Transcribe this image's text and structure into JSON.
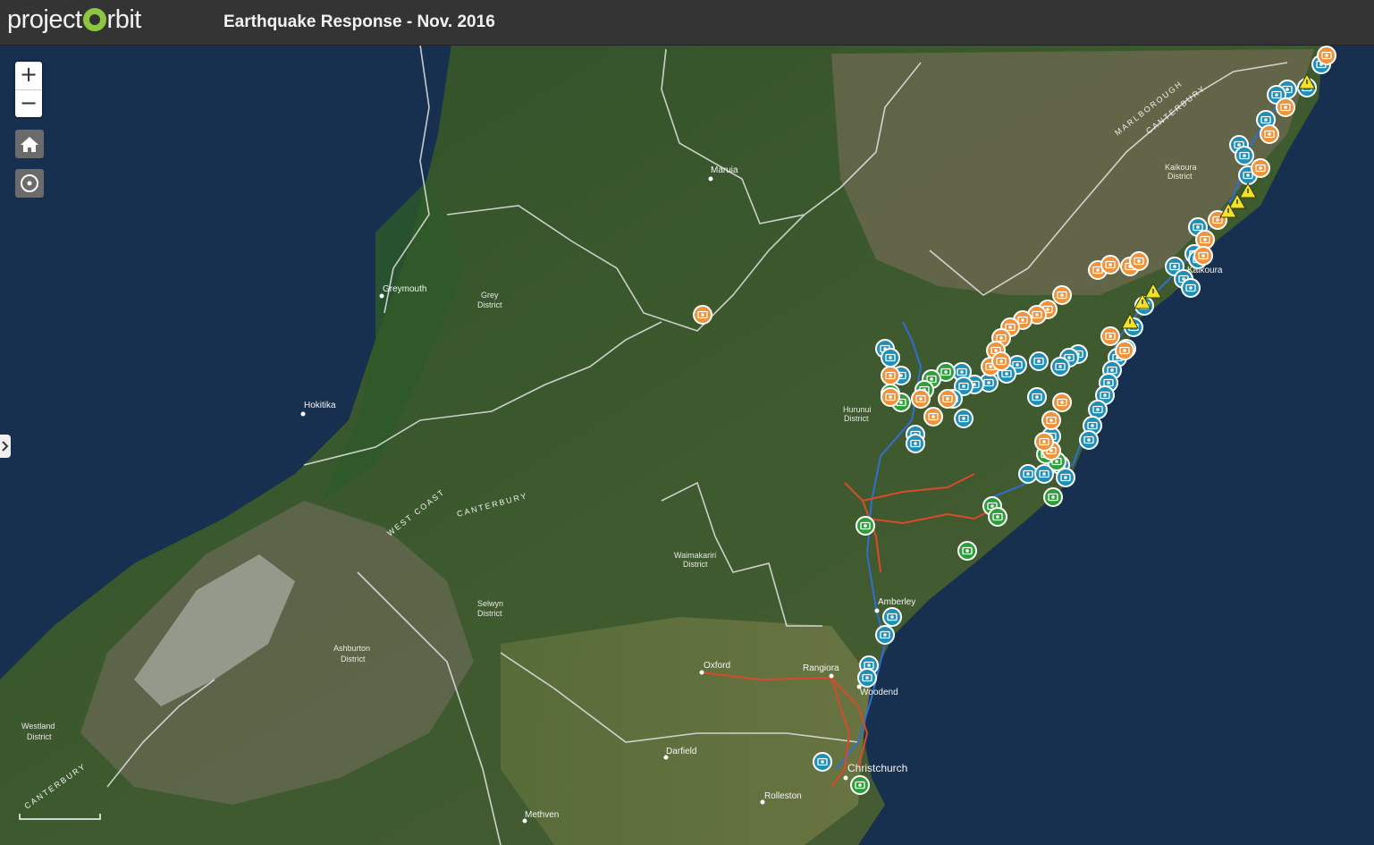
{
  "app": {
    "logo_left": "project",
    "logo_right": "rbit",
    "title": "Earthquake Response - Nov. 2016"
  },
  "controls": {
    "zoom_in": "+",
    "zoom_out": "−"
  },
  "places": {
    "maruia": "Maruia",
    "greymouth": "Greymouth",
    "hokitika": "Hokitika",
    "kaikoura": "Kaikoura",
    "amberley": "Amberley",
    "oxford": "Oxford",
    "rangiora": "Rangiora",
    "woodend": "Woodend",
    "christchurch": "Christchurch",
    "darfield": "Darfield",
    "rolleston": "Rolleston",
    "methven": "Methven"
  },
  "districts": {
    "grey_1": "Grey",
    "grey_2": "District",
    "hurunui_1": "Hurunui",
    "hurunui_2": "District",
    "kaikoura_1": "Kaikoura",
    "kaikoura_2": "District",
    "waimakariri_1": "Waimakariri",
    "waimakariri_2": "District",
    "selwyn_1": "Selwyn",
    "selwyn_2": "District",
    "ashburton_1": "Ashburton",
    "ashburton_2": "District",
    "westland_1": "Westland",
    "westland_2": "District"
  },
  "regions": {
    "west_coast": "WEST COAST",
    "canterbury": "CANTERBURY",
    "marlborough": "MARLBOROUGH",
    "canterbury_ne": "CANTERBURY",
    "canterbury_sw": "CANTERBURY"
  },
  "markers": {
    "colors": {
      "photo_orange": "#f0923a",
      "photo_blue": "#1f8fb5",
      "photo_green": "#2e9e3a",
      "warning": "#f1e12a",
      "route_blue": "#2f6fd0",
      "route_red": "#d94a2a"
    },
    "glyphs": {
      "camera": "◙",
      "warning": "⚠"
    }
  }
}
